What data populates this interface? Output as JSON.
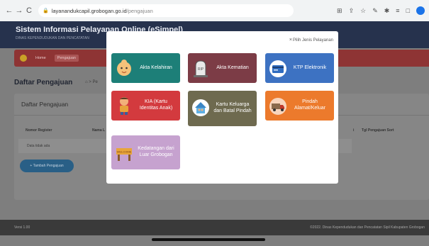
{
  "browser": {
    "url_domain": "layanandukcapil.grobogan.go.id",
    "url_path": "/pengajuan",
    "nav_back": "←",
    "nav_forward": "→",
    "nav_reload": "C",
    "lock": "🔒",
    "toolbar_icons": [
      "⊞",
      "⇪",
      "☆",
      "✎",
      "✱",
      "≡",
      "□"
    ]
  },
  "header": {
    "title": "Sistem Informasi Pelayanan Online (eSimpel)",
    "subtitle": "DINAS KEPENDUDUKAN DAN PENCATATAN"
  },
  "navbar": {
    "items": [
      "Home",
      "Pengajuan"
    ]
  },
  "page": {
    "title": "Daftar Pengajuan",
    "breadcrumb": "⌂ > Pe"
  },
  "card": {
    "title": "Daftar Pengajuan",
    "columns": [
      "Nomor Register",
      "Nama L",
      "i",
      "Tgl Pengajuan Sort"
    ],
    "empty_text": "Data tidak ada",
    "add_button": "+ Tambah Pengajuan"
  },
  "footer": {
    "version": "Versi 1.00",
    "copyright": "©2022. Dinas Kependudukan dan Pencatatan Sipil Kabupaten Grobogan"
  },
  "modal": {
    "close": "×",
    "title": "Pilih Jenis Pelayanan",
    "services": [
      {
        "label": "Akta Kelahiran",
        "color": "#1d7f78"
      },
      {
        "label": "Akta Kematian",
        "color": "#7c3c46"
      },
      {
        "label": "KTP Elektronik",
        "color": "#3d72c2"
      },
      {
        "label": "KIA (Kartu Identitas Anak)",
        "color": "#d33a3e"
      },
      {
        "label": "Kartu Keluarga dan Batal Pindah",
        "color": "#6e6a4f"
      },
      {
        "label": "Pindah Alamat/Keluar",
        "color": "#ec7a2c"
      },
      {
        "label": "Kedatangan dari Luar Grobogan",
        "color": "#c6a2cf"
      }
    ]
  }
}
